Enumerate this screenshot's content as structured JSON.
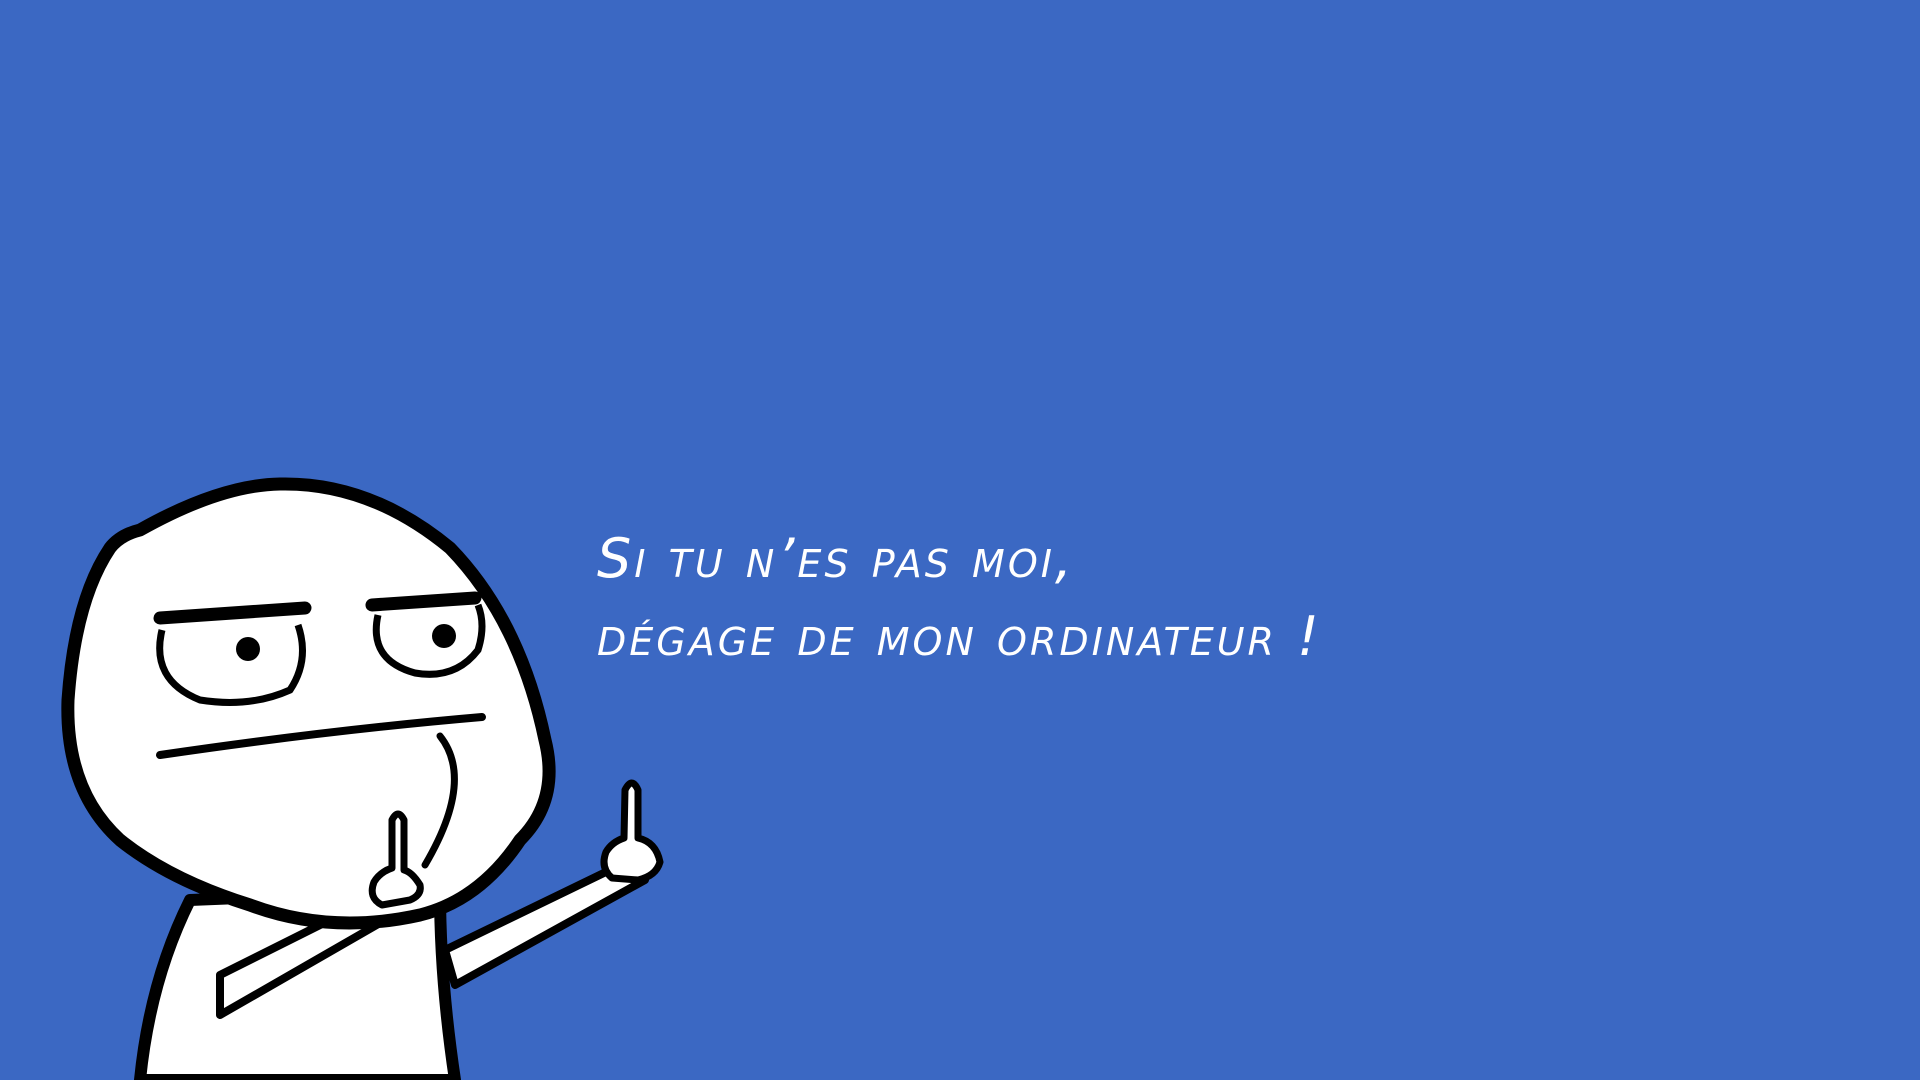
{
  "wallpaper": {
    "background_color": "#3b68c3",
    "illustration": "rage-comic-character-middle-fingers",
    "message": {
      "line1": "Si tu n’es pas moi,",
      "line2": "dégage de mon ordinateur !"
    },
    "text_color": "#ffffff"
  }
}
